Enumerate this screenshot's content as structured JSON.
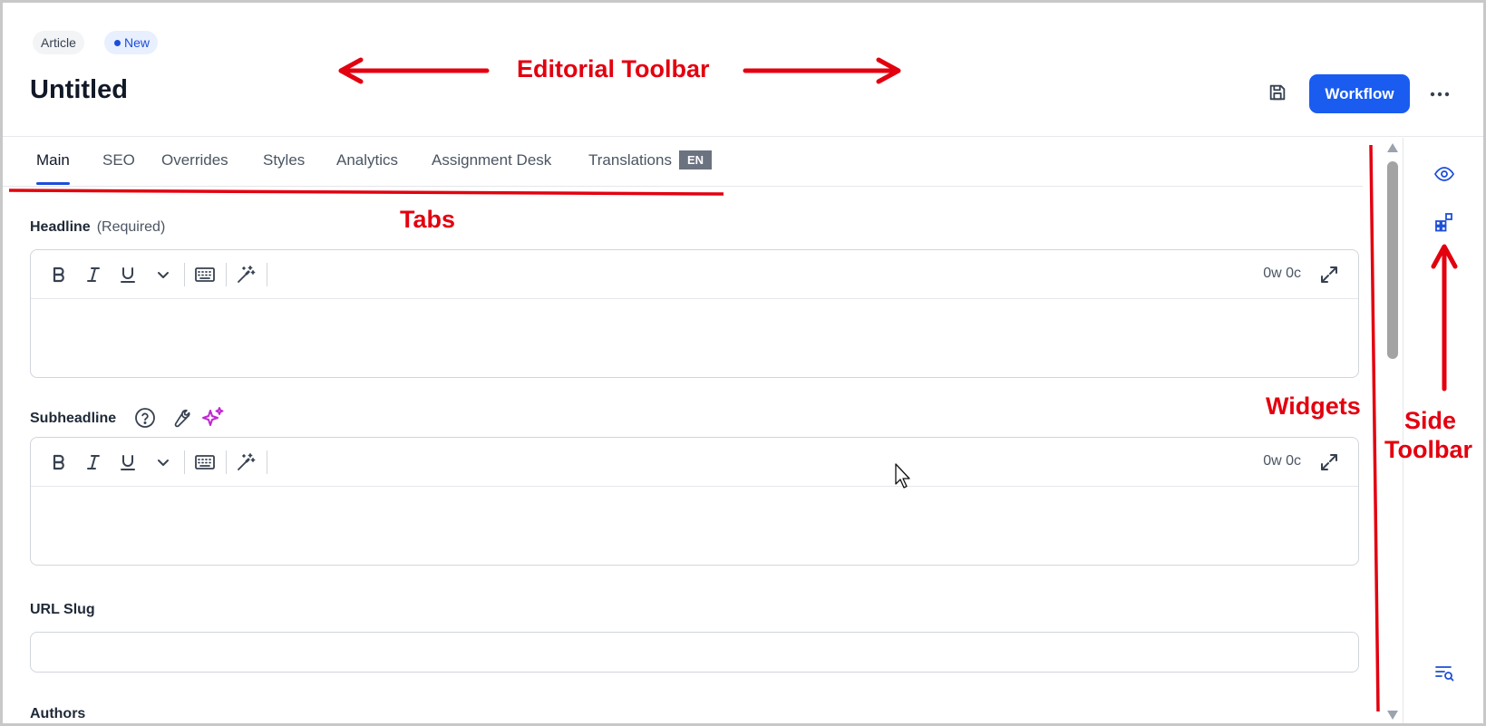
{
  "header": {
    "type_badge": "Article",
    "status_badge": "New",
    "title": "Untitled",
    "workflow_label": "Workflow",
    "accent_color": "#1a5cf0"
  },
  "tabs": [
    {
      "label": "Main",
      "active": true
    },
    {
      "label": "SEO"
    },
    {
      "label": "Overrides"
    },
    {
      "label": "Styles"
    },
    {
      "label": "Analytics"
    },
    {
      "label": "Assignment Desk"
    },
    {
      "label": "Translations",
      "badge": "EN"
    }
  ],
  "fields": {
    "headline": {
      "label": "Headline",
      "hint": "(Required)",
      "count": "0w 0c",
      "value": ""
    },
    "subheadline": {
      "label": "Subheadline",
      "count": "0w 0c",
      "value": ""
    },
    "url_slug": {
      "label": "URL Slug",
      "value": ""
    },
    "authors": {
      "label": "Authors"
    }
  },
  "editor_toolbar_icons": [
    "bold-icon",
    "italic-icon",
    "underline-icon",
    "chevron-down-icon",
    "keyboard-icon",
    "magic-wand-icon"
  ],
  "subheadline_icons": [
    "help-icon",
    "wrench-icon",
    "sparkles-icon"
  ],
  "side_toolbar_icons": [
    "eye-icon",
    "widgets-icon",
    "search-list-icon"
  ],
  "annotations": {
    "editorial_toolbar": "Editorial Toolbar",
    "tabs": "Tabs",
    "widgets": "Widgets",
    "side_toolbar_line1": "Side",
    "side_toolbar_line2": "Toolbar",
    "color": "#e3000f"
  }
}
